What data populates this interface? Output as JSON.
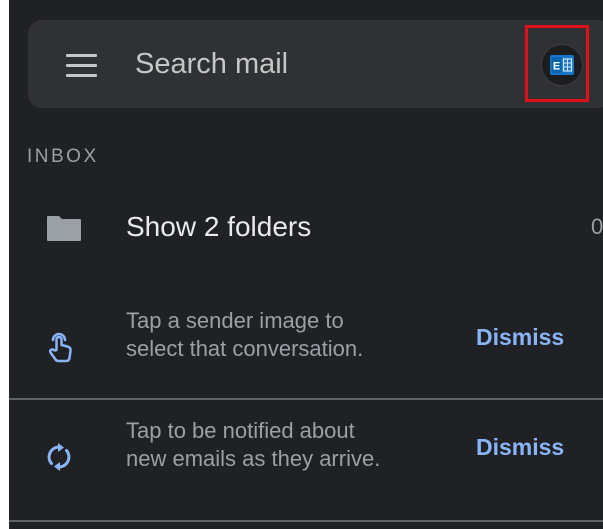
{
  "search": {
    "placeholder": "Search mail",
    "menu_icon": "hamburger-menu-icon",
    "account_icon": "exchange-account-icon",
    "highlight_color": "#e0101a"
  },
  "inbox": {
    "section_label": "INBOX",
    "folders_row": {
      "label": "Show 2 folders",
      "icon": "folder-icon",
      "count": "0"
    }
  },
  "tips": [
    {
      "icon": "tap-gesture-icon",
      "line1": "Tap a sender image to",
      "line2": "select that conversation.",
      "action": "Dismiss"
    },
    {
      "icon": "sync-icon",
      "line1": "Tap to be notified about",
      "line2": "new emails as they arrive.",
      "action": "Dismiss"
    }
  ],
  "colors": {
    "background": "#202124",
    "search_bar": "#303134",
    "accent": "#8ab4f8",
    "secondary_text": "#9aa0a6",
    "primary_text": "#e8eaed",
    "exchange_blue": "#0a64ad"
  }
}
